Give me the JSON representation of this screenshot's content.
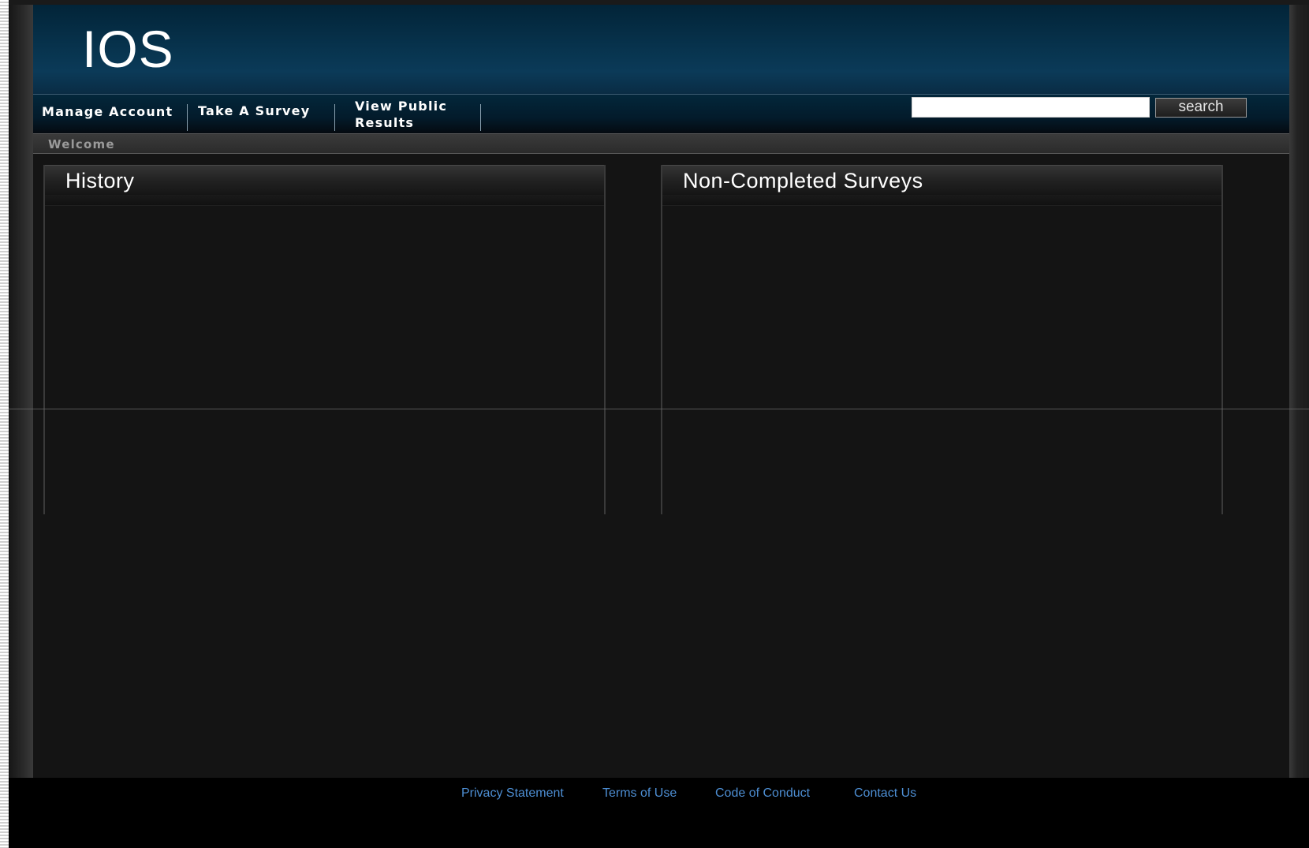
{
  "app": {
    "logo_text": "IOS"
  },
  "nav": {
    "items": [
      {
        "label": "Manage Account"
      },
      {
        "label": "Take A Survey"
      },
      {
        "label_line1": "View Public",
        "label_line2": "Results"
      }
    ]
  },
  "search": {
    "value": "",
    "placeholder": "",
    "button_label": "search"
  },
  "breadcrumb": {
    "current": "Welcome"
  },
  "panels": {
    "history": {
      "title": "History",
      "items": []
    },
    "non_completed": {
      "title": "Non-Completed Surveys",
      "items": []
    }
  },
  "footer": {
    "links": [
      {
        "label": "Privacy Statement"
      },
      {
        "label": "Terms of Use"
      },
      {
        "label": "Code of Conduct"
      },
      {
        "label": "Contact Us"
      }
    ]
  },
  "colors": {
    "header_blue": "#083550",
    "link_blue": "#4d8ed3",
    "panel_bg": "#141414"
  }
}
